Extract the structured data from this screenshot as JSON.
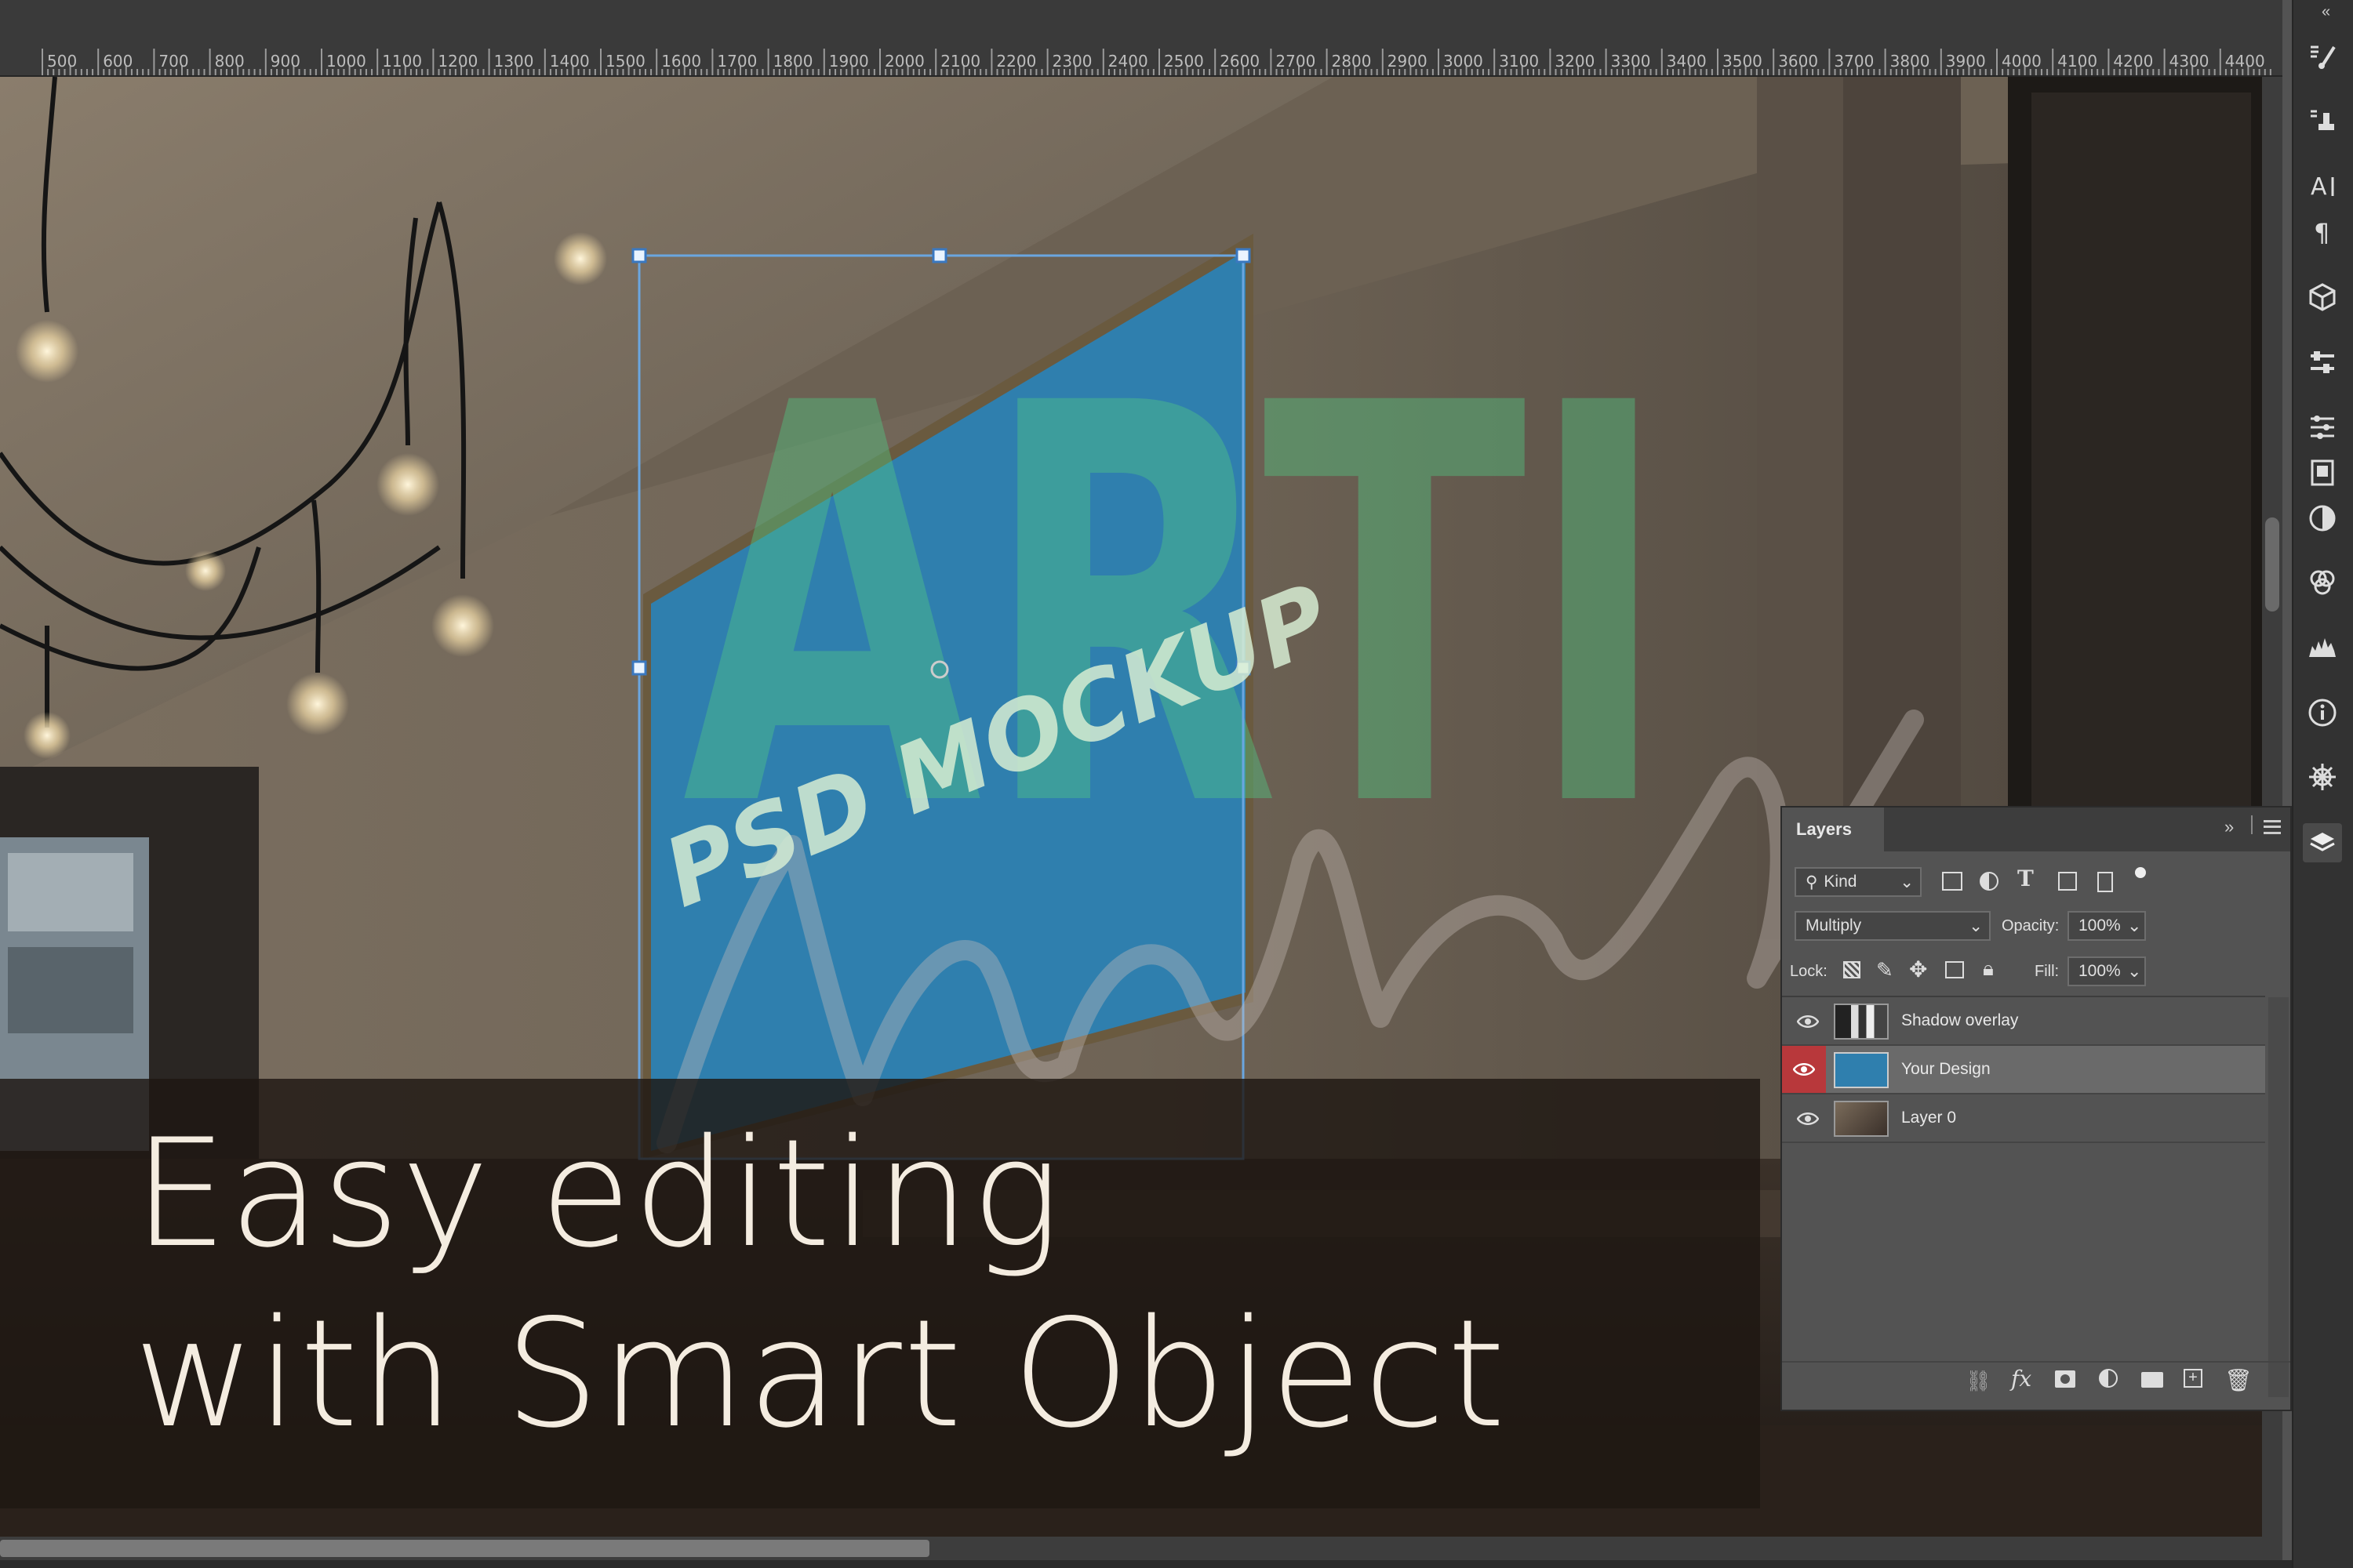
{
  "ruler": {
    "labels": [
      "500",
      "600",
      "700",
      "800",
      "900",
      "1000",
      "1100",
      "1200",
      "1300",
      "1400",
      "1500",
      "1600",
      "1700",
      "1800",
      "1900",
      "2000",
      "2100",
      "2200",
      "2300",
      "2400",
      "2500",
      "2600",
      "2700",
      "2800",
      "2900",
      "3000",
      "3100",
      "3200",
      "3300",
      "3400",
      "3500",
      "3600",
      "3700",
      "3800",
      "3900",
      "4000",
      "4100",
      "4200",
      "4300",
      "4400"
    ]
  },
  "canvas": {
    "mockup_text": "PSD MOCKUP",
    "watermark_bold": "ARTI",
    "watermark_script": "Market"
  },
  "caption": {
    "line1": "Easy editing",
    "line2": "with Smart Object"
  },
  "layers_panel": {
    "tab_label": "Layers",
    "filter_kind": "Kind",
    "blend_mode": "Multiply",
    "opacity_label": "Opacity:",
    "opacity_value": "100%",
    "lock_label": "Lock:",
    "fill_label": "Fill:",
    "fill_value": "100%",
    "layers": [
      {
        "name": "Shadow overlay",
        "visible": true,
        "selected": false
      },
      {
        "name": "Your Design",
        "visible": true,
        "selected": true
      },
      {
        "name": "Layer 0",
        "visible": true,
        "selected": false
      }
    ]
  },
  "tools": [
    "brush-presets-icon",
    "clone-source-icon",
    "character-icon",
    "paragraph-icon",
    "3d-icon",
    "properties-icon",
    "adjustments-icon",
    "libraries-icon",
    "styles-icon",
    "channels-icon",
    "histogram-icon",
    "info-icon",
    "navigator-icon",
    "layers-icon"
  ],
  "colors": {
    "selected_layer": "#6a6a6a",
    "eye_selected_bg": "#b8383b",
    "transform_handle": "#4aa0e8",
    "frame_blue": "#2f7fae"
  }
}
